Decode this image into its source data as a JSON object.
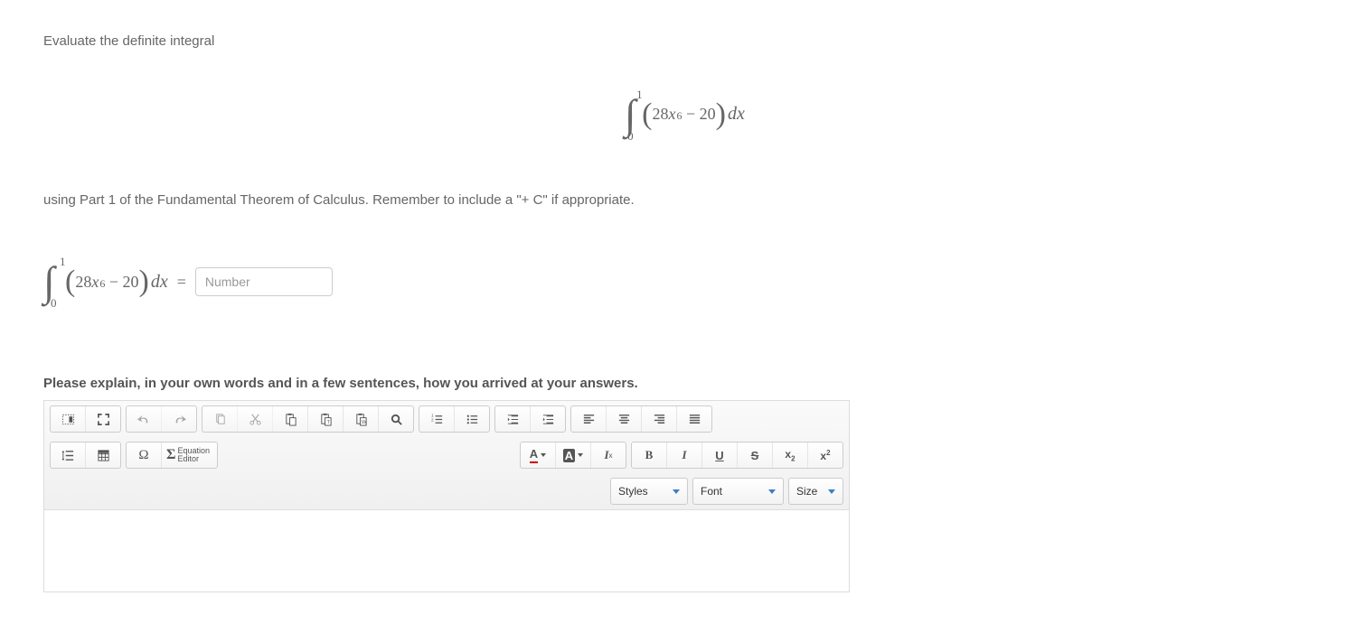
{
  "problem": {
    "intro": "Evaluate the definite integral",
    "integral": {
      "lower": "0",
      "upper": "1",
      "coef1": "28",
      "var": "x",
      "exp": "6",
      "minus_term": "20",
      "dvar": "dx"
    },
    "followup": "using Part 1 of the Fundamental Theorem of Calculus. Remember to include a \"+ C\" if appropriate."
  },
  "answer": {
    "integral": {
      "lower": "0",
      "upper": "1",
      "coef1": "28",
      "var": "x",
      "exp": "6",
      "minus_term": "20",
      "dvar": "dx"
    },
    "equals": "=",
    "placeholder": "Number"
  },
  "explain": {
    "label": "Please explain, in your own words and in a few sentences, how you arrived at your answers."
  },
  "editor": {
    "equation_btn_top": "Equation",
    "equation_btn_bot": "Editor",
    "text_color": "A",
    "bg_color": "A",
    "clear_fmt": "Ix",
    "bold": "B",
    "italic": "I",
    "underline": "U",
    "strike": "S",
    "sub_base": "x",
    "sub_sub": "2",
    "sup_base": "x",
    "sup_sup": "2",
    "sel_styles": "Styles",
    "sel_font": "Font",
    "sel_size": "Size",
    "omega": "Ω",
    "sigma": "Σ"
  }
}
